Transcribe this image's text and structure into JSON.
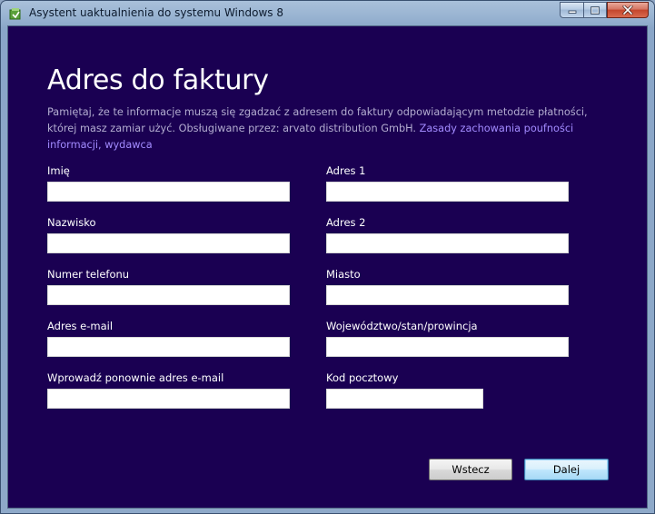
{
  "window": {
    "title": "Asystent uaktualnienia do systemu Windows 8",
    "icon": "windows-setup-icon",
    "buttons": [
      "minimize-icon",
      "maximize-icon",
      "close-icon"
    ]
  },
  "page": {
    "heading": "Adres do faktury",
    "description": "Pamiętaj, że te informacje muszą się zgadzać z adresem do faktury odpowiadającym metodzie płatności, której masz zamiar użyć. Obsługiwane przez: arvato distribution GmbH.",
    "privacy_link": "Zasady zachowania poufności informacji, wydawca"
  },
  "form": {
    "first_name": {
      "label": "Imię",
      "value": ""
    },
    "last_name": {
      "label": "Nazwisko",
      "value": ""
    },
    "phone": {
      "label": "Numer telefonu",
      "value": ""
    },
    "email": {
      "label": "Adres e-mail",
      "value": ""
    },
    "email_confirm": {
      "label": "Wprowadź ponownie adres e-mail",
      "value": ""
    },
    "address1": {
      "label": "Adres 1",
      "value": ""
    },
    "address2": {
      "label": "Adres 2",
      "value": ""
    },
    "city": {
      "label": "Miasto",
      "value": ""
    },
    "state": {
      "label": "Województwo/stan/prowincja",
      "value": ""
    },
    "postal_code": {
      "label": "Kod pocztowy",
      "value": ""
    }
  },
  "buttons": {
    "back": "Wstecz",
    "next": "Dalej"
  },
  "colors": {
    "background": "#1a0052",
    "link": "#a38bff",
    "description_text": "#b3acd0"
  }
}
